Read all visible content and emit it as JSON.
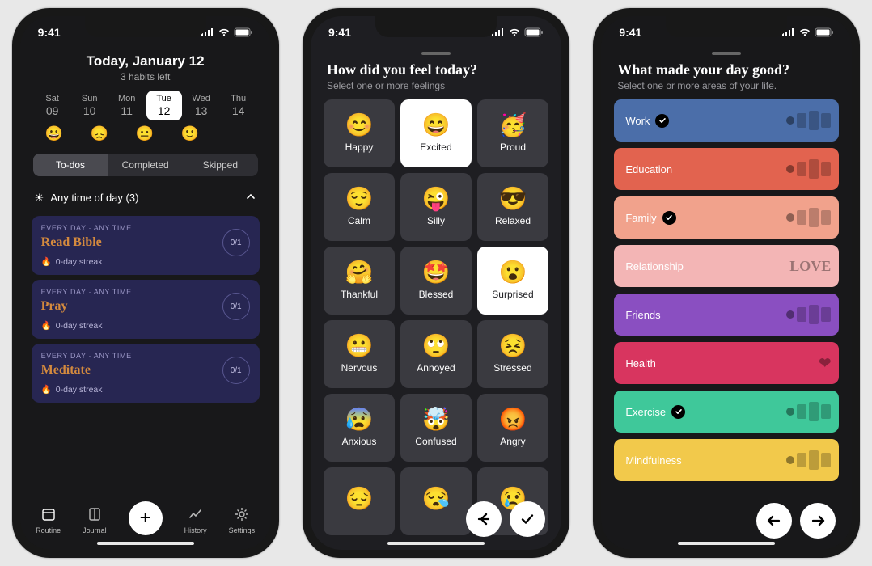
{
  "status": {
    "time": "9:41"
  },
  "screen1": {
    "title": "Today, January 12",
    "subtitle": "3 habits left",
    "days": [
      {
        "dow": "Sat",
        "num": "09",
        "mood": "😀"
      },
      {
        "dow": "Sun",
        "num": "10",
        "mood": "😞"
      },
      {
        "dow": "Mon",
        "num": "11",
        "mood": "😐"
      },
      {
        "dow": "Tue",
        "num": "12",
        "mood": "🙂",
        "active": true
      },
      {
        "dow": "Wed",
        "num": "13"
      },
      {
        "dow": "Thu",
        "num": "14"
      }
    ],
    "segments": {
      "todos": "To-dos",
      "completed": "Completed",
      "skipped": "Skipped"
    },
    "section": "Any time of day (3)",
    "tasks": [
      {
        "meta": "EVERY DAY · ANY TIME",
        "title": "Read Bible",
        "streak": "0-day streak",
        "count": "0/1"
      },
      {
        "meta": "EVERY DAY · ANY TIME",
        "title": "Pray",
        "streak": "0-day streak",
        "count": "0/1"
      },
      {
        "meta": "EVERY DAY · ANY TIME",
        "title": "Meditate",
        "streak": "0-day streak",
        "count": "0/1"
      }
    ],
    "tabs": {
      "routine": "Routine",
      "journal": "Journal",
      "history": "History",
      "settings": "Settings"
    }
  },
  "screen2": {
    "title": "How did you feel today?",
    "subtitle": "Select one or more feelings",
    "feelings": [
      {
        "emoji": "😊",
        "label": "Happy"
      },
      {
        "emoji": "😄",
        "label": "Excited",
        "selected": true
      },
      {
        "emoji": "🥳",
        "label": "Proud"
      },
      {
        "emoji": "😌",
        "label": "Calm"
      },
      {
        "emoji": "😜",
        "label": "Silly"
      },
      {
        "emoji": "😎",
        "label": "Relaxed"
      },
      {
        "emoji": "🤗",
        "label": "Thankful"
      },
      {
        "emoji": "🤩",
        "label": "Blessed"
      },
      {
        "emoji": "😮",
        "label": "Surprised",
        "selected": true
      },
      {
        "emoji": "😬",
        "label": "Nervous"
      },
      {
        "emoji": "🙄",
        "label": "Annoyed"
      },
      {
        "emoji": "😣",
        "label": "Stressed"
      },
      {
        "emoji": "😰",
        "label": "Anxious"
      },
      {
        "emoji": "🤯",
        "label": "Confused"
      },
      {
        "emoji": "😡",
        "label": "Angry"
      },
      {
        "emoji": "😔",
        "label": ""
      },
      {
        "emoji": "😪",
        "label": ""
      },
      {
        "emoji": "😢",
        "label": ""
      }
    ]
  },
  "screen3": {
    "title": "What made your day good?",
    "subtitle": "Select one or more areas of your life.",
    "areas": [
      {
        "label": "Work",
        "color": "#4b6ea9",
        "selected": true,
        "illus": "desk"
      },
      {
        "label": "Education",
        "color": "#e2634f",
        "illus": "present"
      },
      {
        "label": "Family",
        "color": "#f1a28c",
        "selected": true,
        "illus": "photos"
      },
      {
        "label": "Relationship",
        "color": "#f3b5b5",
        "illus": "love"
      },
      {
        "label": "Friends",
        "color": "#8a4fc1",
        "illus": "table"
      },
      {
        "label": "Health",
        "color": "#d8355f",
        "illus": "heart"
      },
      {
        "label": "Exercise",
        "color": "#3fc89a",
        "selected": true,
        "illus": "run"
      },
      {
        "label": "Mindfulness",
        "color": "#f2c94b",
        "illus": "yoga"
      }
    ]
  }
}
